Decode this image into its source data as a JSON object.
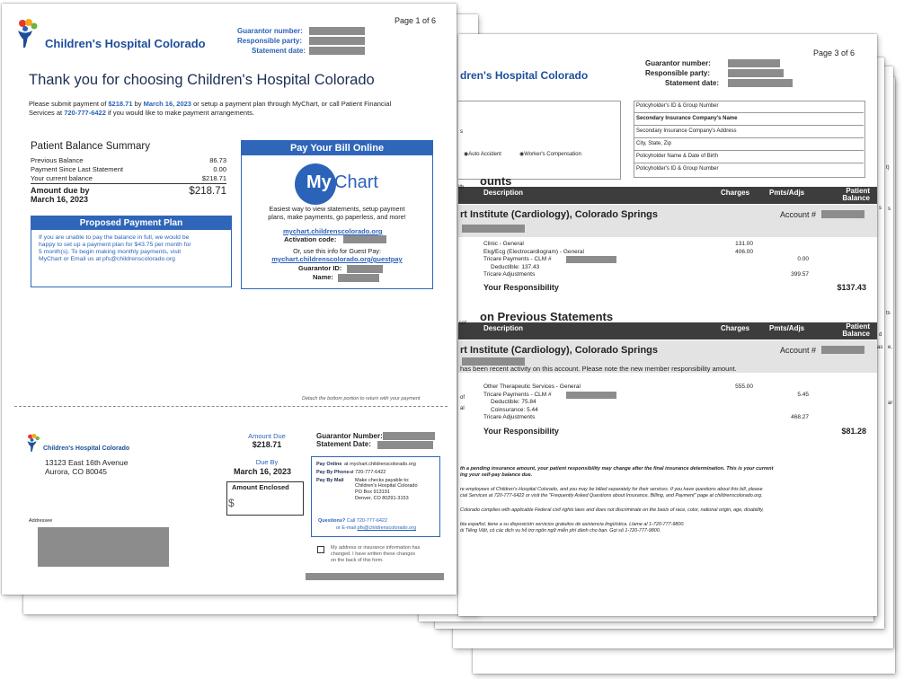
{
  "stack": {
    "edges": 4
  },
  "page1": {
    "page_label": "Page 1 of 6",
    "logo_text": "Children's Hospital Colorado",
    "header_labels": [
      "Guarantor number:",
      "Responsible party:",
      "Statement date:"
    ],
    "heading": "Thank you for choosing Children's Hospital Colorado",
    "intro": {
      "p1": "Please submit payment of ",
      "amount": "$218.71",
      "p2": " by ",
      "date": "March 16, 2023",
      "p3": " or setup a payment plan through MyChart, or call Patient Financial",
      "p4": "Services at ",
      "phone": "720-777-6422",
      "p5": " if you would like to make payment arrangements."
    },
    "summary": {
      "title": "Patient Balance Summary",
      "rows": [
        {
          "label": "Previous Balance",
          "value": "86.73"
        },
        {
          "label": "Payment Since Last Statement",
          "value": "0.00"
        },
        {
          "label": "Your current balance",
          "value": "$218.71"
        }
      ],
      "due_label_1": "Amount due by",
      "due_label_2": "March 16, 2023",
      "due_value": "$218.71"
    },
    "plan": {
      "title": "Proposed Payment Plan",
      "lines": [
        "If you are unable to pay the balance in full, we would be",
        "happy to set up a payment plan for $43.75 per month for",
        "5 month(s). To begin making monthly payments, visit",
        "MyChart or Email us at pfs@childrenscolorado.org"
      ]
    },
    "pay_online": {
      "title": "Pay Your Bill Online",
      "logo_my": "My",
      "logo_chart": "Chart",
      "lines": [
        "Easiest way to view statements, setup payment",
        "plans, make payments, go paperless, and more!"
      ],
      "url": "mychart.childrenscolorado.org",
      "activation_label": "Activation code:",
      "guest_text": "Or, use this info for Guest Pay:",
      "guest_url": "mychart.childrenscolorado.org/guestpay",
      "guarantor_id_label": "Guarantor ID:",
      "name_label": "Name:"
    },
    "detach_text": "Detach the bottom portion to return with your payment",
    "stub": {
      "logo_text": "Children's Hospital Colorado",
      "address_1": "13123 East 16th Avenue",
      "address_2": "Aurora, CO 80045",
      "addressee_label": "Addressee",
      "amount_due_label": "Amount Due",
      "amount_due_value": "$218.71",
      "due_by_label": "Due By",
      "due_by_value": "March 16, 2023",
      "enclosed_label": "Amount Enclosed",
      "dollar": "$",
      "guarantor_number_label": "Guarantor Number:",
      "statement_date_label": "Statement Date:",
      "pay_rows": [
        {
          "label": "Pay Online",
          "value": "at mychart.childrenscolorado.org"
        },
        {
          "label": "Pay By Phone",
          "value": "at 720-777-6422"
        },
        {
          "label": "Pay By Mail",
          "value": "Make checks payable to:"
        }
      ],
      "mail_lines": [
        "Children's Hospital Colorado",
        "PO Box 913191",
        "Denver, CO 80291-3153"
      ],
      "questions_label": "Questions?",
      "questions_phone": "Call 720-777-6422",
      "questions_email_prefix": "or E-mail",
      "questions_email": "pfs@childrenscolorado.org",
      "checkbox_lines": [
        "My address or insurance information has",
        "changed. I have written these changes",
        "on the back of this form."
      ]
    }
  },
  "page3": {
    "page_label": "Page 3 of 6",
    "logo_text_partial": "dren's Hospital Colorado",
    "header_labels": [
      "Guarantor number:",
      "Responsible party:",
      "Statement date:"
    ],
    "left_fields": [
      "s",
      "Auto Accident",
      "Worker's Compensation"
    ],
    "right_fields": [
      "Policyholder's ID & Group Number",
      "Secondary Insurance Company's Name",
      "Secondary Insurance Company's Address",
      "City, State, Zip",
      "Policyholder Name & Date of Birth",
      "Policyholder's ID & Group Number"
    ],
    "section1_title": "ounts",
    "section2_title": "on Previous Statements",
    "columns": [
      "Description",
      "Charges",
      "Pmts/Adjs",
      "Patient Balance"
    ],
    "account1": {
      "title": "rt Institute (Cardiology), Colorado Springs",
      "account_label": "Account #",
      "lines": [
        {
          "desc": "Clinic - General",
          "charge": "131.00",
          "pmt": "",
          "bal": ""
        },
        {
          "desc": "Ekg/Ecg (Electrocardiogram) - General",
          "charge": "406.00",
          "pmt": "",
          "bal": ""
        },
        {
          "desc": "Tricare Payments - CLM #",
          "charge": "",
          "pmt": "0.00",
          "bal": ""
        },
        {
          "desc": "Deductible: 137.43",
          "charge": "",
          "pmt": "",
          "bal": ""
        },
        {
          "desc": "Tricare Adjustments",
          "charge": "",
          "pmt": "399.57",
          "bal": ""
        }
      ],
      "responsibility_label": "Your Responsibility",
      "responsibility_value": "$137.43"
    },
    "account2": {
      "title": "rt Institute (Cardiology), Colorado Springs",
      "account_label": "Account #",
      "notice": "has been recent activity on this account.  Please note the new member responsibility amount.",
      "lines": [
        {
          "desc": "Other Therapeutic Services - General",
          "charge": "555.00",
          "pmt": "",
          "bal": ""
        },
        {
          "desc": "Tricare Payments - CLM #",
          "charge": "",
          "pmt": "5.45",
          "bal": ""
        },
        {
          "desc": "Deductible: 75.84",
          "charge": "",
          "pmt": "",
          "bal": ""
        },
        {
          "desc": "Coinsurance: 5.44",
          "charge": "",
          "pmt": "",
          "bal": ""
        },
        {
          "desc": "Tricare Adjustments",
          "charge": "",
          "pmt": "468.27",
          "bal": ""
        }
      ],
      "responsibility_label": "Your Responsibility",
      "responsibility_value": "$81.28"
    },
    "footnotes": {
      "f1a": "th a pending insurance amount, your patient responsibility may change after the final insurance determination.  This is your current",
      "f1b": "ing your self-pay balance due.",
      "f2a": "re employees of Children's Hospital Colorado, and you may be billed separately for their services.  If you have questions about this bill, please",
      "f2b": "cial Services at 720-777-6422 or visit the \"Frequently Asked Questions about Insurance, Billing, and Payment\" page at childrenscolorado.org.",
      "f3": "Colorado complies with applicable Federal civil rights laws and does not discriminate on the basis of race, color, national origin, age, disability,",
      "f4a": "bla español, tiene a su disposición servicios gratuitos de asistencia lingüística. Llame al 1-720-777-9800.",
      "f4b": "ói Tiếng Việt, có các dịch vụ hỗ trợ ngôn ngữ miễn phí dành cho bạn. Gọi số 1-720-777-9800."
    },
    "left_margin_bits": [
      "set",
      "of",
      "al",
      "ith"
    ],
    "right_margin_bits": [
      "s",
      "t)",
      "s",
      "ts",
      "d",
      "as",
      "e,",
      "ar"
    ]
  },
  "colors": {
    "brand_blue": "#2b63b8",
    "header_blue": "#2f66b9",
    "table_dark": "#3d3d3d",
    "redaction": "#8c8c8c"
  }
}
